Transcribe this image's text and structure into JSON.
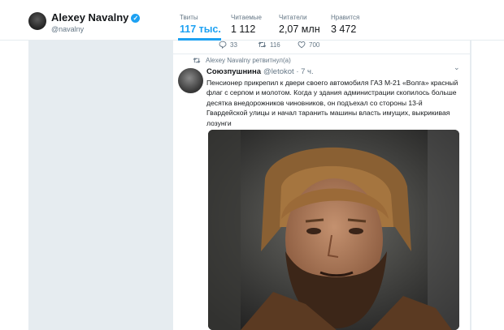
{
  "profile": {
    "name": "Alexey Navalny",
    "handle": "@navalny",
    "verified_symbol": "✓"
  },
  "stats": [
    {
      "label": "Твиты",
      "value": "117 тыс.",
      "active": true
    },
    {
      "label": "Читаемые",
      "value": "1 112"
    },
    {
      "label": "Читатели",
      "value": "2,07 млн"
    },
    {
      "label": "Нравится",
      "value": "3 472"
    }
  ],
  "previous_tweet_actions": {
    "replies": "33",
    "retweets": "116",
    "likes": "700"
  },
  "tweet": {
    "retweet_notice": "Alexey Navalny ретвитнул(а)",
    "author": "Союзпушнина",
    "meta": "@letokot · 7 ч.",
    "text": "Пенсионер прикрепил к двери своего автомобиля ГАЗ М-21 «Волга» красный флаг с серпом и молотом. Когда у здания администрации скопилось больше десятка внедорожников чиновников, он подъехал со стороны 13-й Гвардейской улицы и начал таранить машины власть имущих, выкрикивая лозунги",
    "caret": "⌄"
  },
  "colors": {
    "accent": "#1da1f2",
    "muted": "#657786",
    "background_gray": "#e6ecf0"
  },
  "icons": {
    "verified": "verified-badge-icon",
    "reply": "reply-icon",
    "retweet": "retweet-icon",
    "like": "heart-icon",
    "caret": "chevron-down-icon"
  }
}
